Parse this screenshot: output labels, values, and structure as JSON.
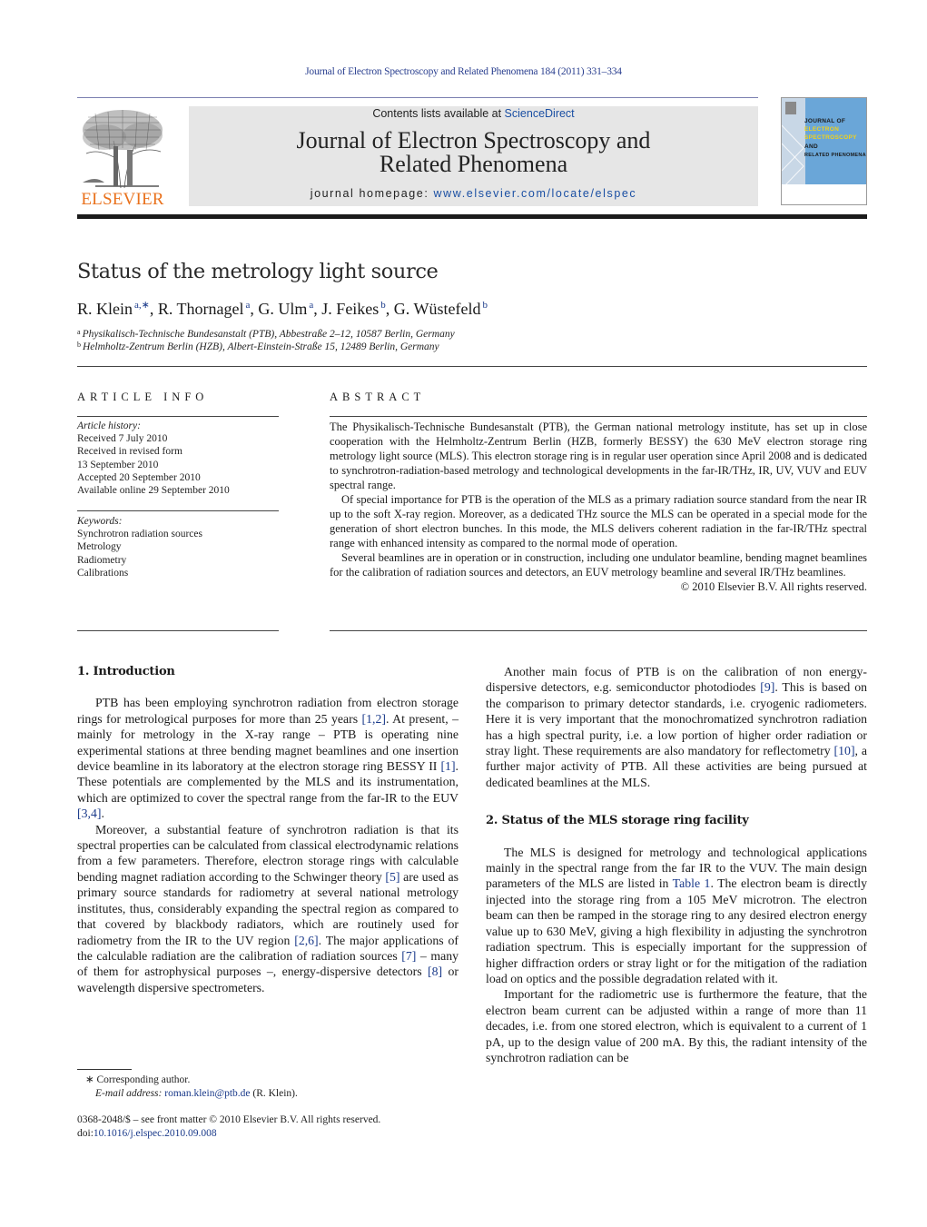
{
  "journal_ref": "Journal of Electron Spectroscopy and Related Phenomena 184 (2011) 331–334",
  "header": {
    "publisher": "ELSEVIER",
    "contents_prefix": "Contents lists available at ",
    "contents_link": "ScienceDirect",
    "journal_title_line1": "Journal of Electron Spectroscopy and",
    "journal_title_line2": "Related Phenomena",
    "homepage_prefix": "journal homepage: ",
    "homepage_url": "www.elsevier.com/locate/elspec",
    "cover": {
      "lines": [
        "JOURNAL OF",
        "ELECTRON",
        "SPECTROSCOPY",
        "AND",
        "RELATED PHENOMENA"
      ],
      "bg_color": "#6aa6d8",
      "accent_color": "#f2d21a"
    }
  },
  "article": {
    "title": "Status of the metrology light source",
    "authors": [
      {
        "name": "R. Klein",
        "sup": "a,∗"
      },
      {
        "name": "R. Thornagel",
        "sup": "a"
      },
      {
        "name": "G. Ulm",
        "sup": "a"
      },
      {
        "name": "J. Feikes",
        "sup": "b"
      },
      {
        "name": "G. Wüstefeld",
        "sup": "b"
      }
    ],
    "affiliations": [
      {
        "key": "a",
        "text": "Physikalisch-Technische Bundesanstalt (PTB), Abbestraße 2–12, 10587 Berlin, Germany"
      },
      {
        "key": "b",
        "text": "Helmholtz-Zentrum Berlin (HZB), Albert-Einstein-Straße 15, 12489 Berlin, Germany"
      }
    ]
  },
  "article_info": {
    "heading": "ARTICLE INFO",
    "history_label": "Article history:",
    "history": [
      "Received 7 July 2010",
      "Received in revised form",
      "13 September 2010",
      "Accepted 20 September 2010",
      "Available online 29 September 2010"
    ],
    "keywords_label": "Keywords:",
    "keywords": [
      "Synchrotron radiation sources",
      "Metrology",
      "Radiometry",
      "Calibrations"
    ]
  },
  "abstract": {
    "heading": "ABSTRACT",
    "paragraphs": [
      "The Physikalisch-Technische Bundesanstalt (PTB), the German national metrology institute, has set up in close cooperation with the Helmholtz-Zentrum Berlin (HZB, formerly BESSY) the 630 MeV electron storage ring metrology light source (MLS). This electron storage ring is in regular user operation since April 2008 and is dedicated to synchrotron-radiation-based metrology and technological developments in the far-IR/THz, IR, UV, VUV and EUV spectral range.",
      "Of special importance for PTB is the operation of the MLS as a primary radiation source standard from the near IR up to the soft X-ray region. Moreover, as a dedicated THz source the MLS can be operated in a special mode for the generation of short electron bunches. In this mode, the MLS delivers coherent radiation in the far-IR/THz spectral range with enhanced intensity as compared to the normal mode of operation.",
      "Several beamlines are in operation or in construction, including one undulator beamline, bending magnet beamlines for the calibration of radiation sources and detectors, an EUV metrology beamline and several IR/THz beamlines."
    ],
    "copyright": "© 2010 Elsevier B.V. All rights reserved."
  },
  "body": {
    "section1_heading": "1.  Introduction",
    "s1p1": [
      "PTB has been employing synchrotron radiation from electron storage rings for metrological purposes for more than 25 years ",
      "[1,2]",
      ". At present, – mainly for metrology in the X-ray range – PTB is operating nine experimental stations at three bending magnet beamlines and one insertion device beamline in its laboratory at the electron storage ring BESSY II ",
      "[1]",
      ". These potentials are complemented by the MLS and its instrumentation, which are optimized to cover the spectral range from the far-IR to the EUV ",
      "[3,4]",
      "."
    ],
    "s1p2": [
      "Moreover, a substantial feature of synchrotron radiation is that its spectral properties can be calculated from classical electrodynamic relations from a few parameters. Therefore, electron storage rings with calculable bending magnet radiation according to the Schwinger theory ",
      "[5]",
      " are used as primary source standards for radiometry at several national metrology institutes, thus, considerably expanding the spectral region as compared to that covered by blackbody radiators, which are routinely used for radiometry from the IR to the UV region ",
      "[2,6]",
      ". The major applications of the calculable radiation are the calibration of radiation sources ",
      "[7]",
      " – many of them for astrophysical purposes –, energy-dispersive detectors ",
      "[8]",
      " or wavelength dispersive spectrometers."
    ],
    "s1p3": [
      "Another main focus of PTB is on the calibration of non energy-dispersive detectors, e.g. semiconductor photodiodes ",
      "[9]",
      ". This is based on the comparison to primary detector standards, i.e. cryogenic radiometers. Here it is very important that the monochromatized synchrotron radiation has a high spectral purity, i.e. a low portion of higher order radiation or stray light. These requirements are also mandatory for reflectometry ",
      "[10]",
      ", a further major activity of PTB. All these activities are being pursued at dedicated beamlines at the MLS."
    ],
    "section2_heading": "2.  Status of the MLS storage ring facility",
    "s2p1": [
      "The MLS is designed for metrology and technological applications mainly in the spectral range from the far IR to the VUV. The main design parameters of the MLS are listed in ",
      "Table 1",
      ". The electron beam is directly injected into the storage ring from a 105 MeV microtron. The electron beam can then be ramped in the storage ring to any desired electron energy value up to 630 MeV, giving a high flexibility in adjusting the synchrotron radiation spectrum. This is especially important for the suppression of higher diffraction orders or stray light or for the mitigation of the radiation load on optics and the possible degradation related with it."
    ],
    "s2p2": "Important for the radiometric use is furthermore the feature, that the electron beam current can be adjusted within a range of more than 11 decades, i.e. from one stored electron, which is equivalent to a current of 1 pA, up to the design value of 200 mA. By this, the radiant intensity of the synchrotron radiation can be"
  },
  "footnotes": {
    "corresponding_mark": "∗",
    "corresponding": "Corresponding author.",
    "email_label": "E-mail address:",
    "email": "roman.klein@ptb.de",
    "email_suffix": " (R. Klein).",
    "front_matter": "0368-2048/$ – see front matter © 2010 Elsevier B.V. All rights reserved.",
    "doi_prefix": "doi:",
    "doi": "10.1016/j.elspec.2010.09.008"
  }
}
